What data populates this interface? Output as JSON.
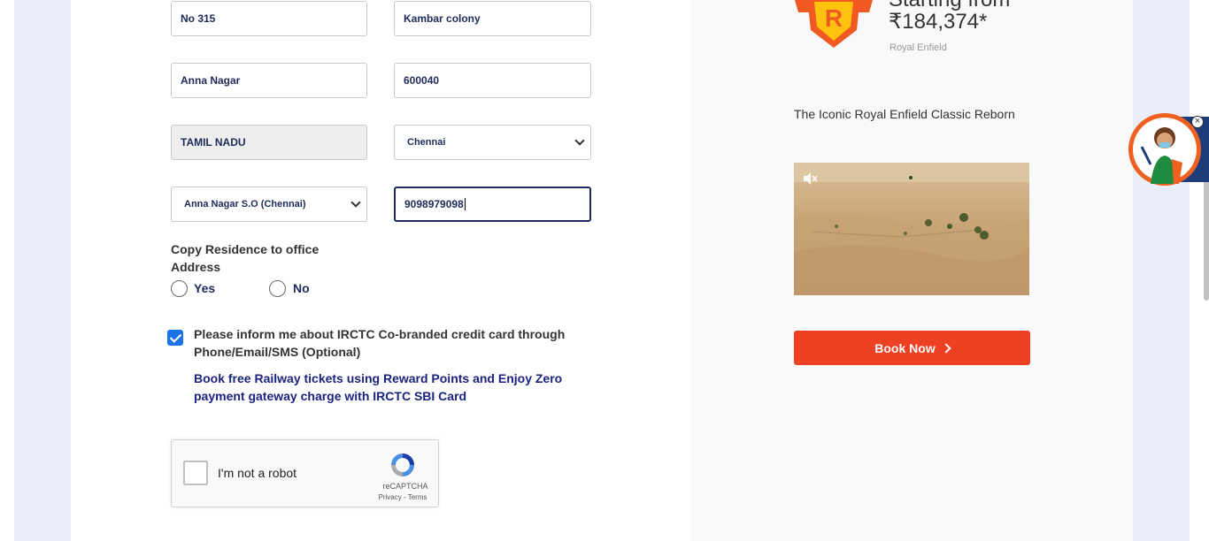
{
  "address": {
    "flat": "No 315",
    "street": "Kambar colony",
    "area": "Anna Nagar",
    "pincode": "600040",
    "state": "TAMIL NADU",
    "city": "Chennai",
    "post_office": "Anna Nagar S.O (Chennai)",
    "phone": "9098979098"
  },
  "copy_address": {
    "label": "Copy Residence to office Address",
    "yes": "Yes",
    "no": "No"
  },
  "consent": {
    "text": "Please inform me about IRCTC Co-branded credit card through Phone/Email/SMS (Optional)",
    "promo": "Book free Railway tickets using Reward Points and Enjoy Zero payment gateway charge with IRCTC SBI Card"
  },
  "captcha": {
    "label": "I'm not a robot",
    "brand": "reCAPTCHA",
    "links": "Privacy - Terms"
  },
  "ad": {
    "starting": "Starting from",
    "price": "₹184,374*",
    "brand": "Royal Enfield",
    "tagline": "The Iconic Royal Enfield Classic Reborn",
    "cta": "Book Now",
    "logo_letter": "R",
    "colors": {
      "cta": "#ee4022",
      "logo_orange": "#f05a22",
      "logo_yellow": "#ffc20e"
    }
  },
  "icons": [
    "mute-icon",
    "chevron-right-icon",
    "recaptcha-icon",
    "chevron-down-icon",
    "close-icon",
    "assistant-avatar-icon"
  ]
}
